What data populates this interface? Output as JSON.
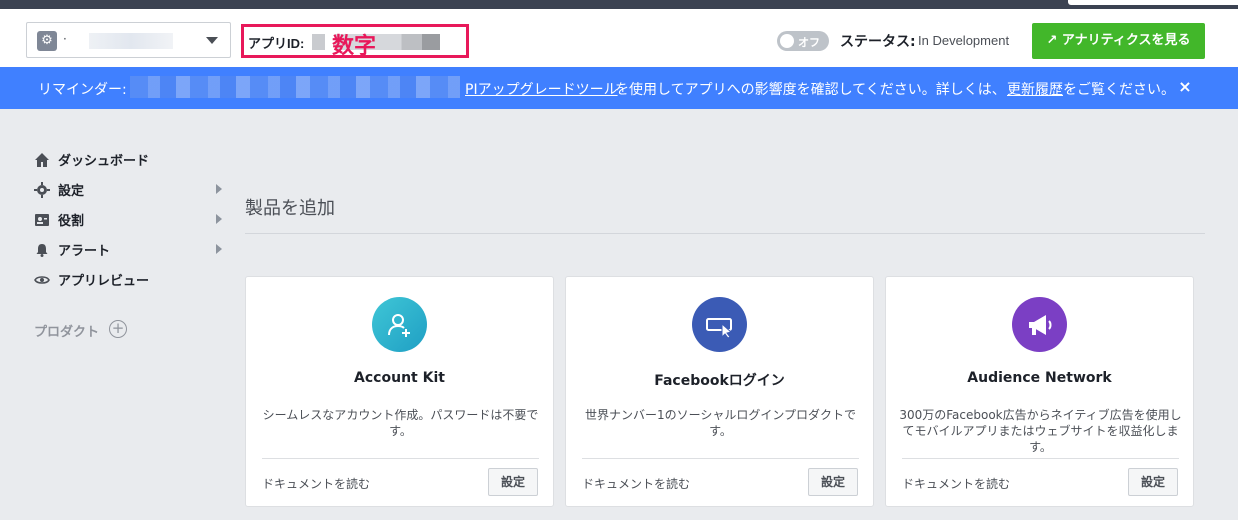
{
  "header": {
    "app_select_name": "·",
    "app_id_label": "アプリID: ",
    "app_id_annotation": "数字",
    "toggle_label": "オフ",
    "status_label": "ステータス: ",
    "status_value": "In Development",
    "analytics_button": "アナリティクスを見る"
  },
  "banner": {
    "label": "リマインダー:",
    "link": "PIアップグレードツール",
    "text": "を使用してアプリへの影響度を確認してください。詳しくは、",
    "link2": "更新履歴",
    "tail": "をご覧ください。",
    "close": "×"
  },
  "sidebar": {
    "items": [
      {
        "label": "ダッシュボード",
        "icon": "home-icon"
      },
      {
        "label": "設定",
        "icon": "gear-icon"
      },
      {
        "label": "役割",
        "icon": "id-card-icon"
      },
      {
        "label": "アラート",
        "icon": "bell-icon"
      },
      {
        "label": "アプリレビュー",
        "icon": "eye-icon"
      }
    ],
    "products_label": "プロダクト",
    "products_add": "+"
  },
  "main": {
    "section_title": "製品を追加",
    "cards": [
      {
        "title": "Account Kit",
        "desc": "シームレスなアカウント作成。パスワードは不要です。",
        "doc": "ドキュメントを読む",
        "set": "設定",
        "icon": "add-user-icon",
        "color": "#2bb3c7"
      },
      {
        "title": "Facebookログイン",
        "desc": "世界ナンバー1のソーシャルログインプロダクトです。",
        "doc": "ドキュメントを読む",
        "set": "設定",
        "icon": "login-cursor-icon",
        "color": "#3b5bb5"
      },
      {
        "title": "Audience Network",
        "desc": "300万のFacebook広告からネイティブ広告を使用してモバイルアプリまたはウェブサイトを収益化します。",
        "doc": "ドキュメントを読む",
        "set": "設定",
        "icon": "megaphone-icon",
        "color": "#7b3fc4"
      }
    ]
  },
  "colors": {
    "banner": "#4080ff",
    "analytics": "#42b72a",
    "highlight": "#e8185a"
  }
}
